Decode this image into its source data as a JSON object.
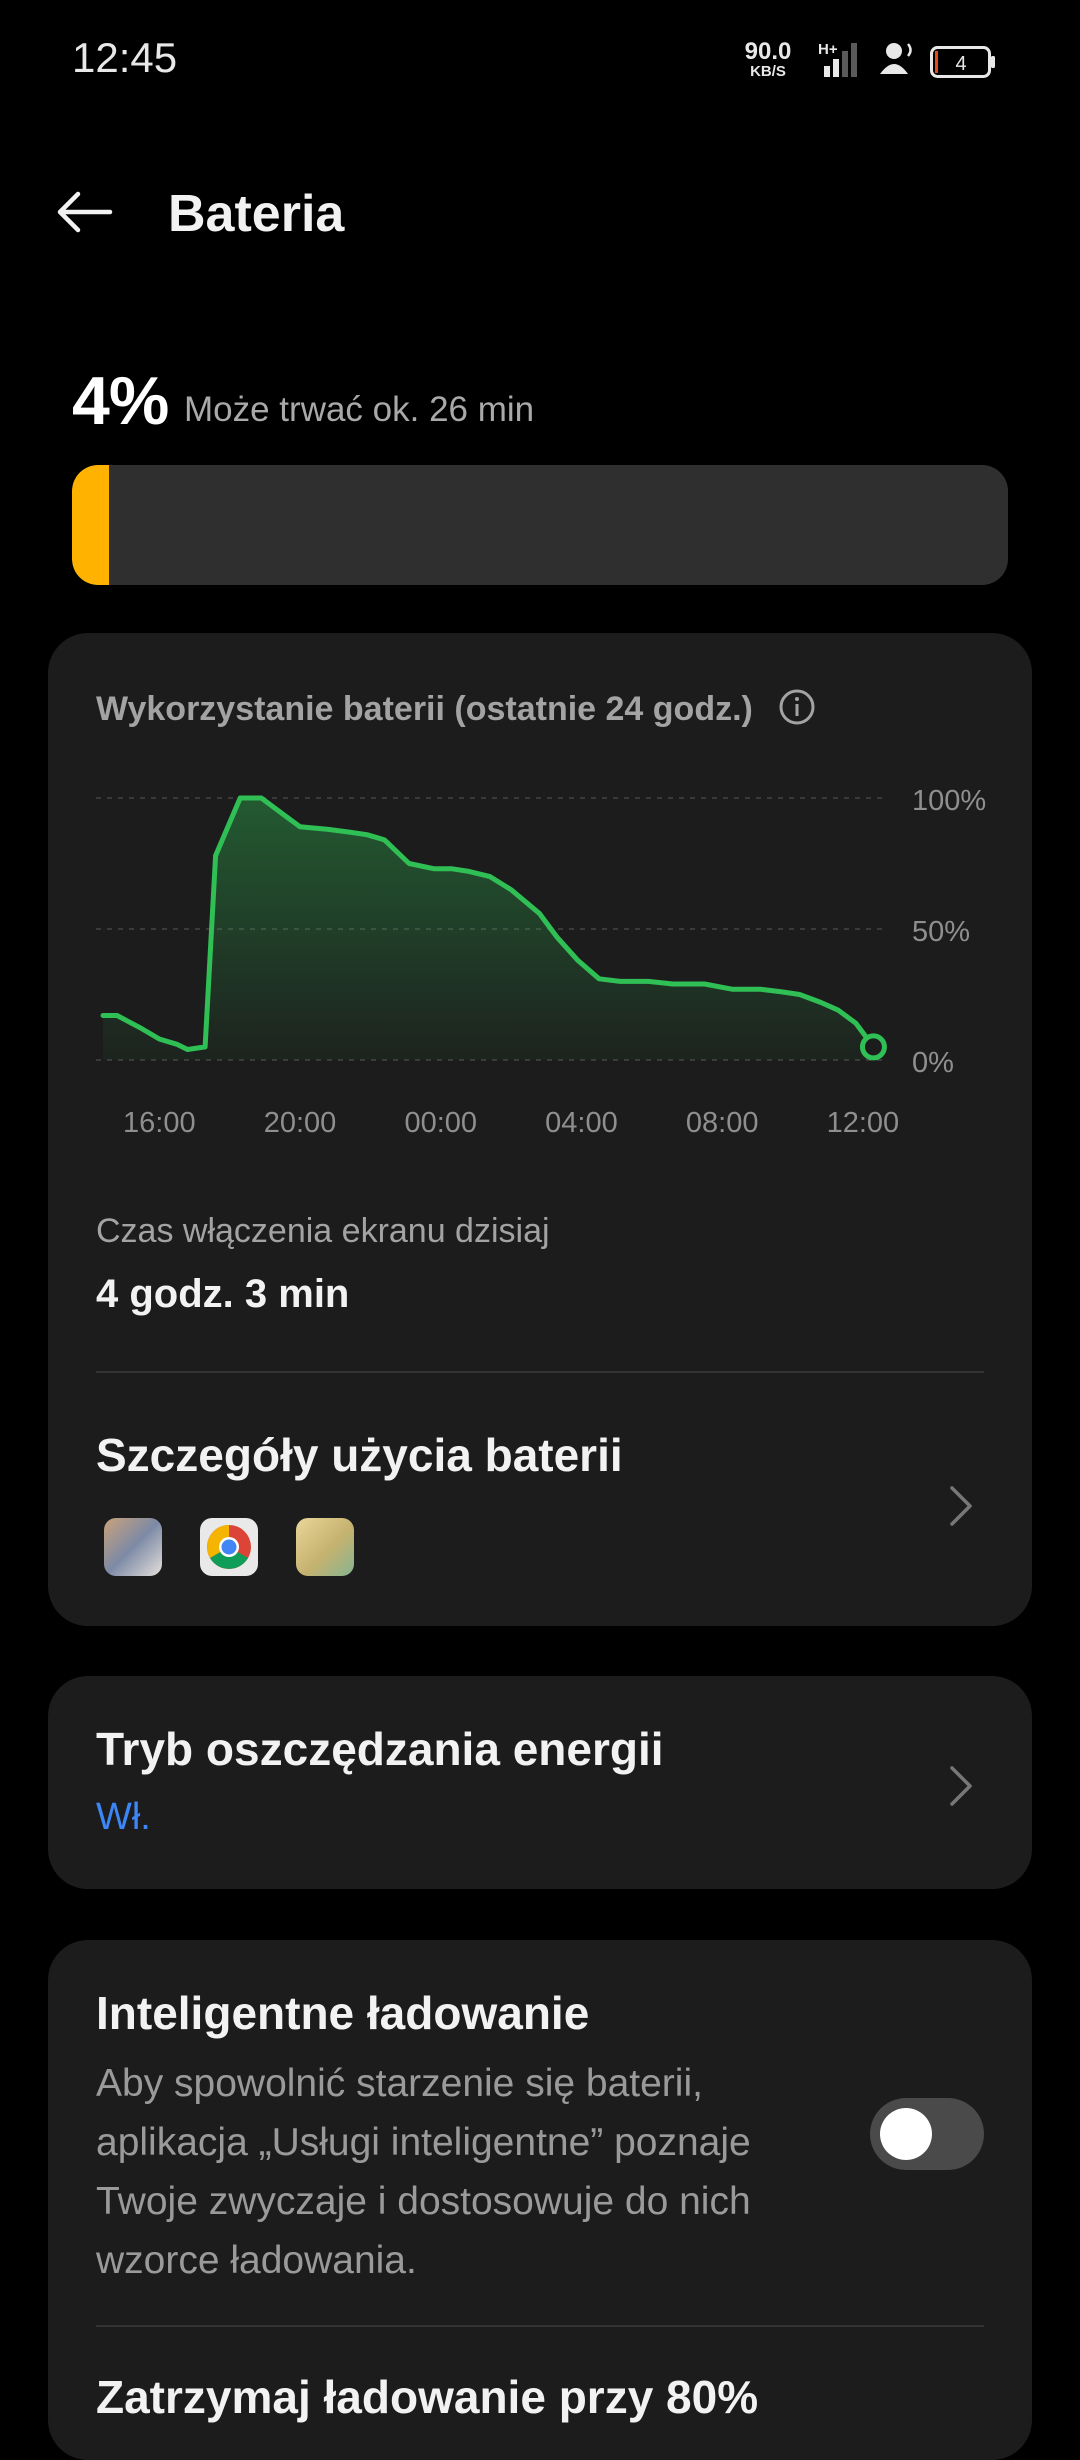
{
  "status_bar": {
    "time": "12:45",
    "net_speed": "90.0",
    "net_unit": "KB/S",
    "network_type": "H+",
    "battery_level": "4"
  },
  "header": {
    "title": "Bateria"
  },
  "battery": {
    "percent": "4%",
    "estimate": "Może trwać ok. 26 min",
    "fill_fraction": 0.04,
    "accent_color": "#ffb300"
  },
  "usage_card": {
    "title": "Wykorzystanie baterii (ostatnie 24 godz.)",
    "screen_time_label": "Czas włączenia ekranu dzisiaj",
    "screen_time_value": "4 godz. 3 min",
    "details_title": "Szczegóły użycia baterii",
    "app_icons": [
      "game-app-icon",
      "chrome-icon",
      "game-app-icon"
    ]
  },
  "chart_data": {
    "type": "line",
    "title": "",
    "xlabel": "",
    "ylabel": "",
    "x_ticks": [
      "16:00",
      "20:00",
      "00:00",
      "04:00",
      "08:00",
      "12:00"
    ],
    "y_ticks": [
      "100%",
      "50%",
      "0%"
    ],
    "ylim": [
      0,
      100
    ],
    "xlim": [
      14.2,
      36.6
    ],
    "grid": true,
    "line_color": "#2fbf55",
    "series": [
      {
        "name": "",
        "x": [
          14.4,
          14.8,
          15.5,
          16.0,
          16.5,
          16.8,
          17.3,
          17.6,
          18.3,
          18.9,
          19.5,
          20.0,
          20.8,
          21.4,
          21.9,
          22.4,
          23.1,
          23.8,
          24.3,
          24.8,
          25.4,
          26.0,
          26.8,
          27.3,
          27.9,
          28.5,
          29.1,
          29.9,
          30.6,
          31.5,
          32.3,
          33.1,
          33.7,
          34.2,
          34.8,
          35.3,
          35.8,
          36.3
        ],
        "y": [
          17,
          17,
          12,
          8,
          6,
          4,
          5,
          78,
          100,
          100,
          94,
          89,
          88,
          87,
          86,
          84,
          75,
          73,
          73,
          72,
          70,
          65,
          56,
          47,
          38,
          31,
          30,
          30,
          29,
          29,
          27,
          27,
          26,
          25,
          22,
          19,
          14,
          5
        ]
      }
    ]
  },
  "power_saving": {
    "title": "Tryb oszczędzania energii",
    "state": "Wł.",
    "state_color": "#3d86f5"
  },
  "smart_charging": {
    "title": "Inteligentne ładowanie",
    "description": "Aby spowolnić starzenie się baterii, aplikacja „Usługi inteligentne” poznaje Twoje zwyczaje i dostosowuje do nich wzorce ładowania.",
    "enabled": false,
    "stop_title": "Zatrzymaj ładowanie przy 80%"
  }
}
